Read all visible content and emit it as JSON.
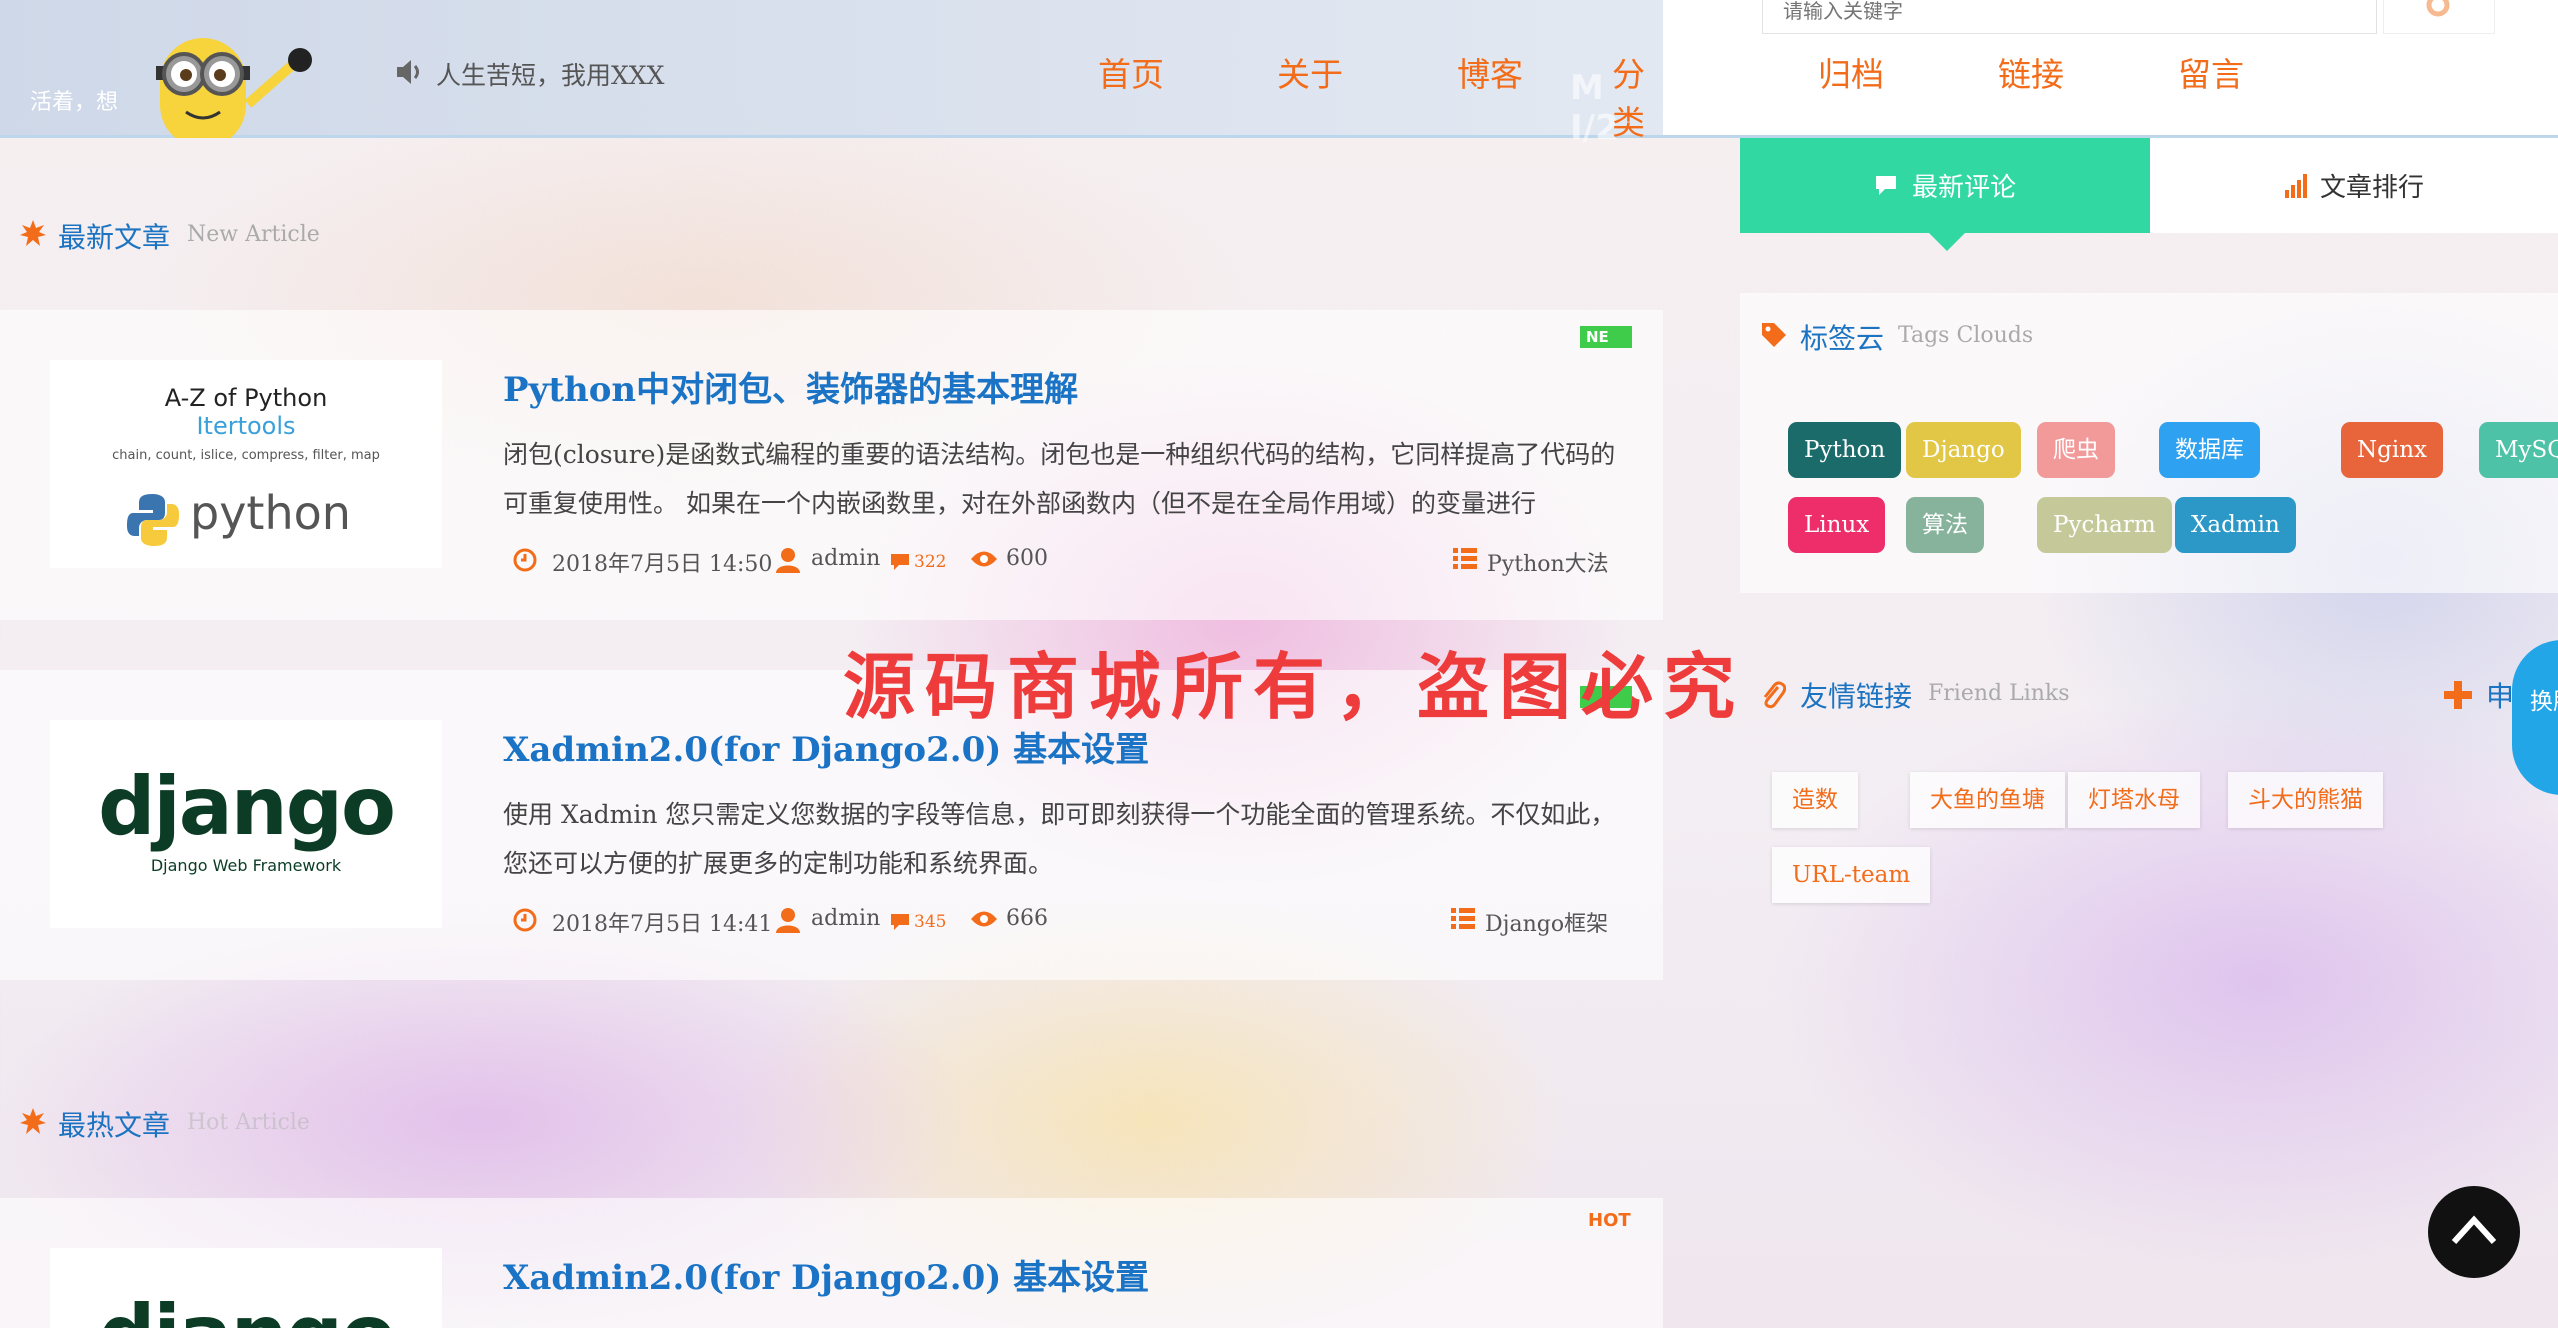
{
  "header": {
    "slogan_left": "活着，想",
    "motto": "人生苦短，我用XXX",
    "logo_watermark": "M Ⅰ/2",
    "nav": [
      "首页",
      "关于",
      "博客",
      "分类",
      "归档",
      "链接",
      "留言"
    ],
    "search_placeholder": "请输入关键字"
  },
  "sections": {
    "latest": {
      "title": "最新文章",
      "sub": "New Article"
    },
    "hot": {
      "title": "最热文章",
      "sub": "Hot Article"
    }
  },
  "articles": [
    {
      "title": "Python中对闭包、装饰器的基本理解",
      "summary": "闭包(closure)是函数式编程的重要的语法结构。闭包也是一种组织代码的结构，它同样提高了代码的可重复使用性。 如果在一个内嵌函数里，对在外部函数内（但不是在全局作用域）的变量进行",
      "date": "2018年7月5日 14:50",
      "author": "admin",
      "comments": "322",
      "views": "600",
      "category": "Python大法",
      "badge": "NE",
      "thumb": {
        "line1": "A-Z of Python",
        "line2": "Itertools",
        "line3": "chain, count, islice, compress, filter, map",
        "logo": "python"
      }
    },
    {
      "title": "Xadmin2.0(for Django2.0) 基本设置",
      "summary": "使用 Xadmin 您只需定义您数据的字段等信息，即可即刻获得一个功能全面的管理系统。不仅如此，您还可以方便的扩展更多的定制功能和系统界面。",
      "date": "2018年7月5日 14:41",
      "author": "admin",
      "comments": "345",
      "views": "666",
      "category": "Django框架",
      "badge": "",
      "thumb": {
        "logo": "django",
        "sub": "Django Web Framework"
      }
    }
  ],
  "hot_articles": [
    {
      "title": "Xadmin2.0(for Django2.0) 基本设置",
      "badge": "HOT",
      "thumb": {
        "logo": "django"
      }
    }
  ],
  "sidebar": {
    "tabs": [
      "最新评论",
      "文章排行"
    ],
    "tags_title": "标签云",
    "tags_sub": "Tags Clouds",
    "tags": [
      {
        "label": "Python",
        "color": "#1b6b6b"
      },
      {
        "label": "Django",
        "color": "#e2c645"
      },
      {
        "label": "爬虫",
        "color": "#f29a9a"
      },
      {
        "label": "数据库",
        "color": "#2ea1f0"
      },
      {
        "label": "Nginx",
        "color": "#e8653c"
      },
      {
        "label": "MySQL",
        "color": "#4ec2a6"
      },
      {
        "label": "Linux",
        "color": "#ee2e6a"
      },
      {
        "label": "算法",
        "color": "#87b39c"
      },
      {
        "label": "Pycharm",
        "color": "#c5c99a"
      },
      {
        "label": "Xadmin",
        "color": "#2c98c8"
      }
    ],
    "links_title": "友情链接",
    "links_sub": "Friend Links",
    "apply_label": "申",
    "links": [
      "造数",
      "大鱼的鱼塘",
      "灯塔水母",
      "斗大的熊猫",
      "URL-team"
    ],
    "skin_label": "换肤"
  },
  "watermark": "源码商城所有，盗图必究",
  "colors": {
    "accent": "#f26c1a",
    "link": "#1a73c4",
    "tab": "#31d8a2"
  }
}
